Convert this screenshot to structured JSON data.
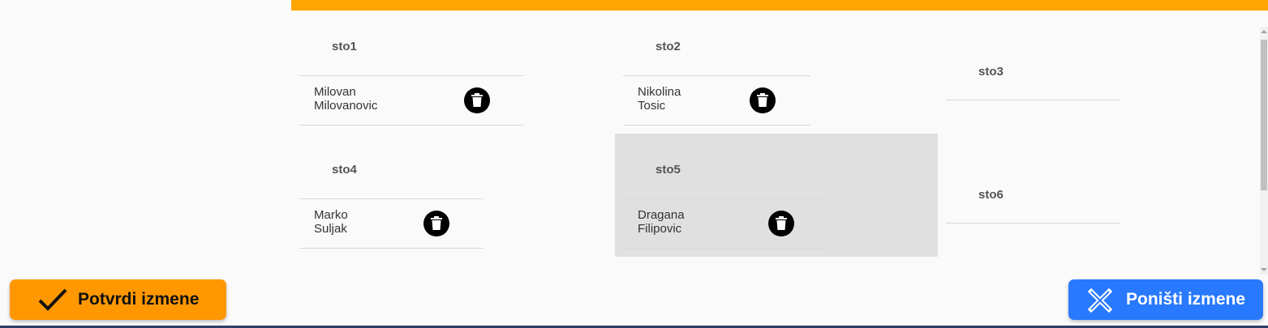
{
  "tables": [
    {
      "title": "sto1",
      "guests": [
        "Milovan Milovanovic"
      ]
    },
    {
      "title": "sto2",
      "guests": [
        "Nikolina Tosic"
      ]
    },
    {
      "title": "sto3",
      "guests": []
    },
    {
      "title": "sto4",
      "guests": [
        "Marko Suljak"
      ]
    },
    {
      "title": "sto5",
      "guests": [
        "Dragana Filipovic"
      ]
    },
    {
      "title": "sto6",
      "guests": []
    }
  ],
  "actions": {
    "confirm_label": "Potvrdi izmene",
    "cancel_label": "Poništi izmene"
  },
  "icons": {
    "confirm": "checkmark-icon",
    "cancel": "x-mark-icon",
    "delete": "trash-icon"
  },
  "colors": {
    "accent": "#ffa500",
    "confirm_button": "#ff9800",
    "cancel_button": "#2979ff",
    "selected_cell": "#e0e0e0"
  }
}
